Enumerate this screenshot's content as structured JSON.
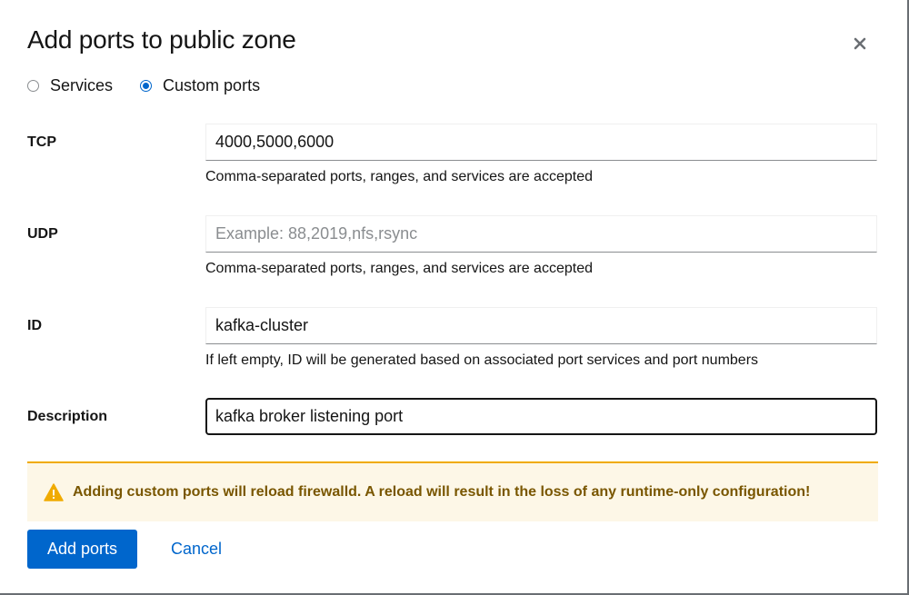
{
  "dialog": {
    "title": "Add ports to public zone",
    "close_icon": "close-icon"
  },
  "mode": {
    "options": [
      {
        "label": "Services",
        "selected": false
      },
      {
        "label": "Custom ports",
        "selected": true
      }
    ]
  },
  "fields": {
    "tcp": {
      "label": "TCP",
      "value": "4000,5000,6000",
      "placeholder": "",
      "helper": "Comma-separated ports, ranges, and services are accepted"
    },
    "udp": {
      "label": "UDP",
      "value": "",
      "placeholder": "Example: 88,2019,nfs,rsync",
      "helper": "Comma-separated ports, ranges, and services are accepted"
    },
    "id": {
      "label": "ID",
      "value": "kafka-cluster",
      "placeholder": "",
      "helper": "If left empty, ID will be generated based on associated port services and port numbers"
    },
    "description": {
      "label": "Description",
      "value": "kafka broker listening port",
      "placeholder": ""
    }
  },
  "alert": {
    "icon": "warning-icon",
    "text": "Adding custom ports will reload firewalld. A reload will result in the loss of any runtime-only configuration!",
    "color": "#795600",
    "accent": "#f0ab00"
  },
  "actions": {
    "primary_label": "Add ports",
    "cancel_label": "Cancel"
  },
  "colors": {
    "primary": "#0066cc"
  }
}
